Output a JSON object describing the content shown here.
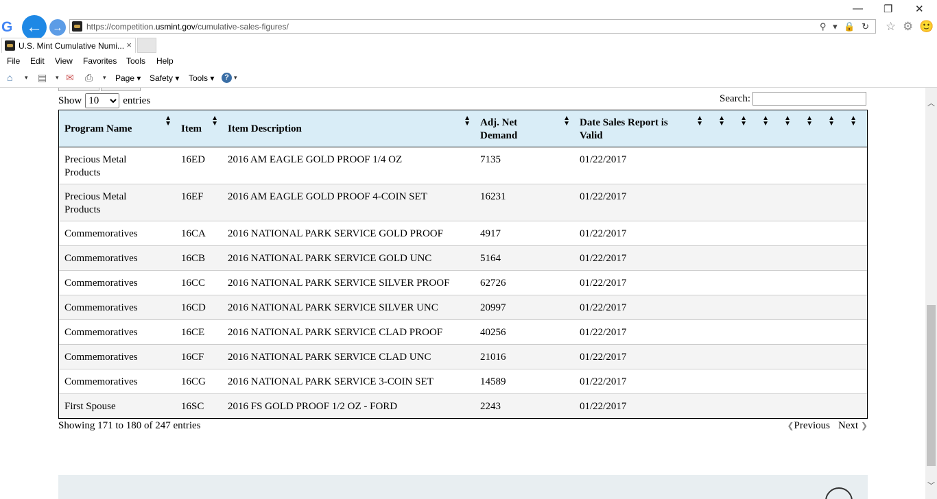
{
  "browser": {
    "url_prefix": "https://competition.",
    "url_domain": "usmint.gov",
    "url_path": "/cumulative-sales-figures/",
    "tab_title": "U.S. Mint Cumulative Numi...",
    "tab_close": "×",
    "google_logo": "G",
    "back_glyph": "←",
    "forward_glyph": "→",
    "addr_tools": "⚲ ▾ 🔒 ↻",
    "minimize": "—",
    "restore": "❐",
    "close": "✕",
    "favorites_star": "☆",
    "gear": "⚙",
    "smiley": "🙂"
  },
  "menu": [
    "File",
    "Edit",
    "View",
    "Favorites",
    "Tools",
    "Help"
  ],
  "commands": {
    "home_icon": "⌂",
    "feeds_icon": "▤",
    "mail_icon": "✉",
    "print_icon": "⎙",
    "caret": "▾",
    "page": "Page",
    "safety": "Safety",
    "tools": "Tools",
    "help": "?"
  },
  "table_controls": {
    "show_label": "Show",
    "entries_label": "entries",
    "page_length": "10",
    "search_label": "Search:",
    "search_value": ""
  },
  "table": {
    "sort_glyph": "▲\n▼",
    "headers": [
      {
        "label": "Program Name"
      },
      {
        "label": "Item"
      },
      {
        "label": "Item Description"
      },
      {
        "label": "Adj. Net\nDemand"
      },
      {
        "label": "Date Sales Report is\nValid"
      }
    ],
    "rows": [
      {
        "program": "Precious Metal\nProducts",
        "item": "16ED",
        "desc": "2016 AM EAGLE GOLD PROOF 1/4 OZ",
        "demand": "7135",
        "date": "01/22/2017"
      },
      {
        "program": "Precious Metal\nProducts",
        "item": "16EF",
        "desc": "2016 AM EAGLE GOLD PROOF 4-COIN SET",
        "demand": "16231",
        "date": "01/22/2017"
      },
      {
        "program": "Commemoratives",
        "item": "16CA",
        "desc": "2016 NATIONAL PARK SERVICE GOLD PROOF",
        "demand": "4917",
        "date": "01/22/2017"
      },
      {
        "program": "Commemoratives",
        "item": "16CB",
        "desc": "2016 NATIONAL PARK SERVICE GOLD UNC",
        "demand": "5164",
        "date": "01/22/2017"
      },
      {
        "program": "Commemoratives",
        "item": "16CC",
        "desc": "2016 NATIONAL PARK SERVICE SILVER PROOF",
        "demand": "62726",
        "date": "01/22/2017"
      },
      {
        "program": "Commemoratives",
        "item": "16CD",
        "desc": "2016 NATIONAL PARK SERVICE SILVER UNC",
        "demand": "20997",
        "date": "01/22/2017"
      },
      {
        "program": "Commemoratives",
        "item": "16CE",
        "desc": "2016 NATIONAL PARK SERVICE CLAD PROOF",
        "demand": "40256",
        "date": "01/22/2017"
      },
      {
        "program": "Commemoratives",
        "item": "16CF",
        "desc": "2016 NATIONAL PARK SERVICE CLAD UNC",
        "demand": "21016",
        "date": "01/22/2017"
      },
      {
        "program": "Commemoratives",
        "item": "16CG",
        "desc": "2016 NATIONAL PARK SERVICE 3-COIN SET",
        "demand": "14589",
        "date": "01/22/2017"
      },
      {
        "program": "First Spouse",
        "item": "16SC",
        "desc": "2016 FS GOLD PROOF 1/2 OZ - FORD",
        "demand": "2243",
        "date": "01/22/2017"
      }
    ]
  },
  "pagination": {
    "info": "Showing 171 to 180 of 247 entries",
    "prev_arrow": "❮",
    "previous": "Previous",
    "next": "Next",
    "next_arrow": "❯"
  },
  "scrollbar": {
    "up": "︿",
    "down": "﹀"
  }
}
